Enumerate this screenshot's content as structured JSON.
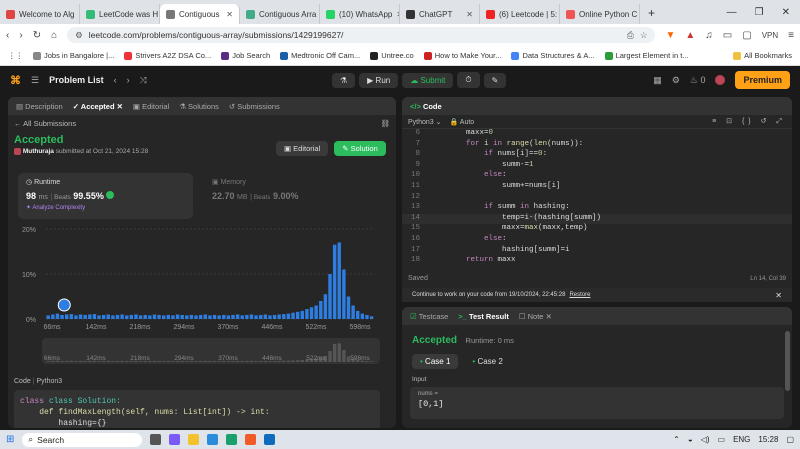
{
  "browser": {
    "tabs": [
      {
        "label": "Welcome to Alg",
        "color": "#d44",
        "active": false
      },
      {
        "label": "LeetCode was H",
        "color": "#3b7",
        "active": false
      },
      {
        "label": "Contiguous",
        "color": "#777",
        "active": true
      },
      {
        "label": "Contiguous Arra",
        "color": "#4a8",
        "active": false
      },
      {
        "label": "(10) WhatsApp",
        "color": "#25d366",
        "active": false
      },
      {
        "label": "ChatGPT",
        "color": "#333",
        "active": false
      },
      {
        "label": "(6) Leetcode | 5:",
        "color": "#e22",
        "active": false
      },
      {
        "label": "Online Python C",
        "color": "#e55",
        "active": false
      }
    ],
    "url": "leetcode.com/problems/contiguous-array/submissions/1429199627/",
    "vpn": "VPN",
    "bookmarks": [
      {
        "label": "Jobs in Bangalore |...",
        "color": "#888"
      },
      {
        "label": "Strivers A2Z DSA Co...",
        "color": "#e33"
      },
      {
        "label": "Job Search",
        "color": "#5a2d82"
      },
      {
        "label": "Medtronic Off Cam...",
        "color": "#1a5fa8"
      },
      {
        "label": "Untree.co",
        "color": "#222"
      },
      {
        "label": "How to Make Your...",
        "color": "#c22"
      },
      {
        "label": "Data Structures & A...",
        "color": "#4285f4"
      },
      {
        "label": "Largest Element in t...",
        "color": "#2c9b3a"
      }
    ],
    "all_bookmarks": "All Bookmarks"
  },
  "lc": {
    "problem_list": "Problem List",
    "run": "Run",
    "submit": "Submit",
    "coins": "0",
    "premium": "Premium"
  },
  "left": {
    "tabs": [
      "Description",
      "Accepted",
      "Editorial",
      "Solutions",
      "Submissions"
    ],
    "all_submissions": "All Submissions",
    "status": "Accepted",
    "submitter": "Muthuraja",
    "submitted_text": "submitted at Oct 21, 2024 15:28",
    "editorial_btn": "Editorial",
    "solution_btn": "Solution",
    "runtime_label": "Runtime",
    "runtime_value": "98",
    "runtime_unit": "ms",
    "beats_label": "Beats",
    "runtime_beats": "99.55%",
    "analyze": "Analyze Complexity",
    "memory_label": "Memory",
    "memory_value": "22.70",
    "memory_unit": "MB",
    "memory_beats": "9.00%",
    "code_label": "Code",
    "lang": "Python3",
    "code_lines": [
      "class Solution:",
      "    def findMaxLength(self, nums: List[int]) -> int:",
      "        hashing={}"
    ]
  },
  "chart_data": {
    "type": "bar",
    "ylabel": "",
    "yticks": [
      "20%",
      "10%",
      "0%"
    ],
    "ylim": [
      0,
      20
    ],
    "xticks": [
      "66ms",
      "142ms",
      "218ms",
      "294ms",
      "370ms",
      "446ms",
      "522ms",
      "598ms"
    ],
    "values": [
      0.8,
      1.0,
      1.2,
      0.9,
      1.0,
      1.1,
      0.8,
      1.0,
      0.9,
      1.0,
      1.1,
      0.8,
      0.9,
      1.0,
      0.8,
      0.9,
      1.0,
      0.8,
      0.9,
      1.0,
      0.8,
      0.9,
      0.8,
      1.0,
      0.9,
      0.8,
      0.9,
      0.8,
      1.0,
      0.9,
      0.8,
      0.9,
      0.8,
      0.9,
      1.0,
      0.8,
      0.9,
      0.8,
      0.9,
      0.8,
      0.9,
      1.0,
      0.8,
      0.9,
      1.0,
      0.8,
      0.9,
      1.0,
      0.8,
      0.9,
      1.0,
      1.1,
      1.2,
      1.4,
      1.6,
      1.8,
      2.2,
      2.6,
      3.0,
      4.0,
      5.5,
      10.0,
      16.5,
      17.0,
      11.0,
      5.0,
      3.0,
      1.8,
      1.2,
      0.9,
      0.6
    ]
  },
  "editor": {
    "header": "Code",
    "lang": "Python3",
    "auto": "Auto",
    "lines": [
      {
        "n": "6",
        "t": "        maxx=0"
      },
      {
        "n": "7",
        "t": "        for i in range(len(nums)):"
      },
      {
        "n": "8",
        "t": "            if nums[i]==0:"
      },
      {
        "n": "9",
        "t": "                summ-=1"
      },
      {
        "n": "10",
        "t": "            else:"
      },
      {
        "n": "11",
        "t": "                summ+=nums[i]"
      },
      {
        "n": "12",
        "t": ""
      },
      {
        "n": "13",
        "t": "            if summ in hashing:"
      },
      {
        "n": "14",
        "t": "                temp=i-(hashing[summ])"
      },
      {
        "n": "15",
        "t": "                maxx=max(maxx,temp)"
      },
      {
        "n": "16",
        "t": "            else:"
      },
      {
        "n": "17",
        "t": "                hashing[summ]=i"
      },
      {
        "n": "18",
        "t": "        return maxx"
      }
    ],
    "saved": "Saved",
    "cursor": "Ln 14, Col 39",
    "restore_msg": "Continue to work on your code from 19/10/2024, 22:45:28",
    "restore": "Restore"
  },
  "console": {
    "tabs": [
      "Testcase",
      "Test Result",
      "Note"
    ],
    "status": "Accepted",
    "runtime": "Runtime: 0 ms",
    "cases": [
      "Case 1",
      "Case 2"
    ],
    "input_label": "Input",
    "var_label": "nums =",
    "var_value": "[0,1]"
  },
  "taskbar": {
    "search": "Search",
    "lang": "ENG",
    "time": "15:28"
  }
}
